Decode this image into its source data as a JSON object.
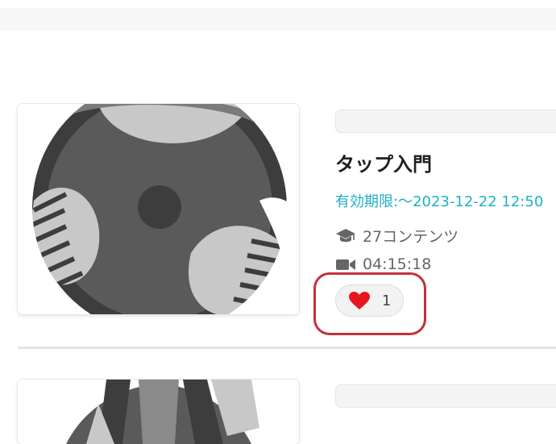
{
  "course": {
    "title": "タップ入門",
    "expiry": "有効期限:～2023-12-22 12:50",
    "contents_count": "27コンテンツ",
    "duration": "04:15:18",
    "like_count": "1"
  },
  "icons": {
    "contents": "graduation-cap-icon",
    "duration": "video-camera-icon",
    "like": "heart-icon"
  },
  "colors": {
    "expiry_text": "#1fb0c8",
    "heart": "#e8141e",
    "highlight_border": "#c6303a"
  }
}
